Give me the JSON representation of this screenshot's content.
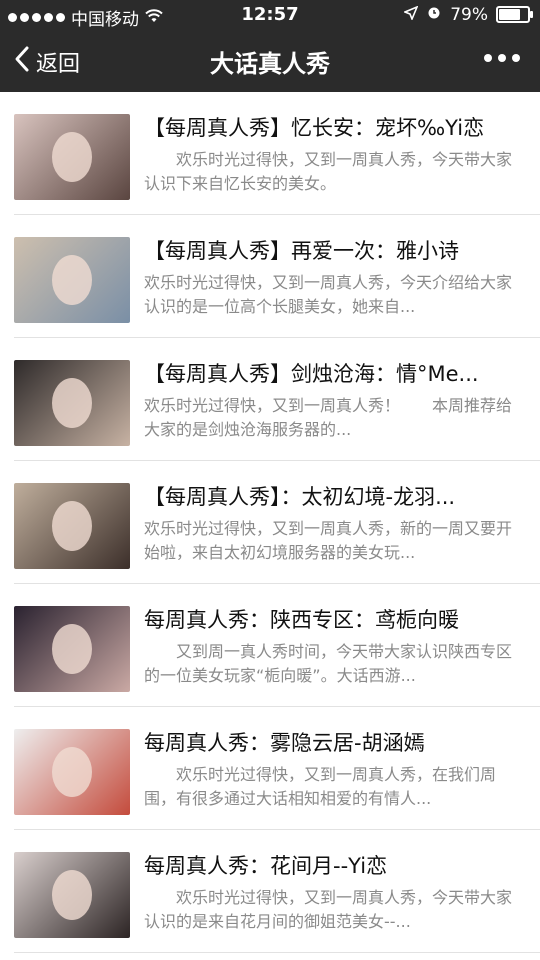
{
  "status": {
    "carrier": "中国移动",
    "time": "12:57",
    "battery": "79%",
    "battery_level": 0.79
  },
  "nav": {
    "back_label": "返回",
    "title": "大话真人秀"
  },
  "articles": [
    {
      "title": "【每周真人秀】忆长安：宠坏‰Yi恋",
      "desc": "　　欢乐时光过得快，又到一周真人秀，今天带大家认识下来自忆长安的美女。",
      "thumb_colors": [
        "#d8c3be",
        "#5a4540"
      ]
    },
    {
      "title": "【每周真人秀】再爱一次：雅小诗",
      "desc": "欢乐时光过得快，又到一周真人秀，今天介绍给大家认识的是一位高个长腿美女，她来自...",
      "thumb_colors": [
        "#cdbfae",
        "#7a8fa6"
      ]
    },
    {
      "title": "【每周真人秀】剑烛沧海：情°Me...",
      "desc": "欢乐时光过得快，又到一周真人秀！　　本周推荐给大家的是剑烛沧海服务器的...",
      "thumb_colors": [
        "#2e2a2a",
        "#c7b2a3"
      ]
    },
    {
      "title": "【每周真人秀】：太初幻境-龙羽...",
      "desc": "欢乐时光过得快，又到一周真人秀，新的一周又要开始啦，来自太初幻境服务器的美女玩...",
      "thumb_colors": [
        "#bfae9c",
        "#3c2f2a"
      ]
    },
    {
      "title": "每周真人秀：陕西专区：鸢栀向暖",
      "desc": "　　又到周一真人秀时间，今天带大家认识陕西专区的一位美女玩家“栀向暖”。大话西游...",
      "thumb_colors": [
        "#2a2230",
        "#caa9a4"
      ]
    },
    {
      "title": "每周真人秀：雾隐云居-胡涵嫣",
      "desc": "　　欢乐时光过得快，又到一周真人秀，在我们周围，有很多通过大话相知相爱的有情人...",
      "thumb_colors": [
        "#eeeeee",
        "#c44b3c"
      ]
    },
    {
      "title": "每周真人秀：花间月--Yi恋",
      "desc": "　　欢乐时光过得快，又到一周真人秀，今天带大家认识的是来自花月间的御姐范美女--...",
      "thumb_colors": [
        "#d9cfcd",
        "#2c2424"
      ]
    }
  ]
}
